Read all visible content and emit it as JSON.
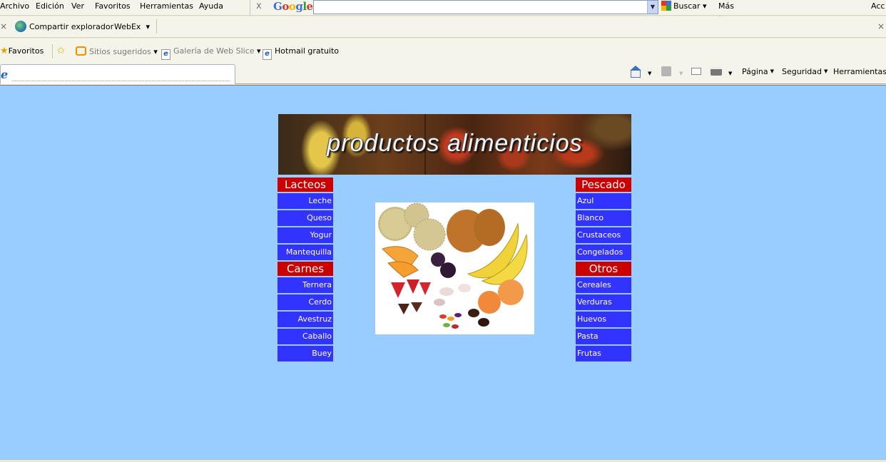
{
  "browser": {
    "menu": [
      "Archivo",
      "Edición",
      "Ver",
      "Favoritos",
      "Herramientas",
      "Ayuda"
    ],
    "menu_right": "Acc",
    "google_toolbar": {
      "logo": [
        "G",
        "o",
        "o",
        "g",
        "l",
        "e"
      ],
      "close": "x",
      "search_value": "",
      "buscar": "Buscar",
      "mas": "Más »"
    },
    "links": {
      "share": "Compartir explorador",
      "webex": "WebEx"
    },
    "favorites": {
      "favoritos": "Favoritos",
      "sitios": "Sitios sugeridos",
      "galeria": "Galería de Web Slice",
      "hotmail": "Hotmail gratuito"
    },
    "tab_icon": "e",
    "commands": {
      "pagina": "Página",
      "seguridad": "Seguridad",
      "herramientas": "Herramientas"
    }
  },
  "page": {
    "banner_title": "productos alimenticios",
    "left_column": {
      "lacteos": {
        "title": "Lacteos",
        "items": [
          "Leche",
          "Queso",
          "Yogur",
          "Mantequilla"
        ]
      },
      "carnes": {
        "title": "Carnes",
        "items": [
          "Ternera",
          "Cerdo",
          "Avestruz",
          "Caballo",
          "Buey"
        ]
      }
    },
    "right_column": {
      "pescado": {
        "title": "Pescado",
        "items": [
          "Azul",
          "Blanco",
          "Crustaceos",
          "Congelados"
        ]
      },
      "otros": {
        "title": "Otros",
        "items": [
          "Cereales",
          "Verduras",
          "Huevos",
          "Pasta",
          "Frutas"
        ]
      }
    }
  },
  "colors": {
    "page_bg": "#99ccff",
    "category_bg": "#cc0000",
    "link_bg": "#3333ff",
    "link_text": "#ffffff"
  }
}
